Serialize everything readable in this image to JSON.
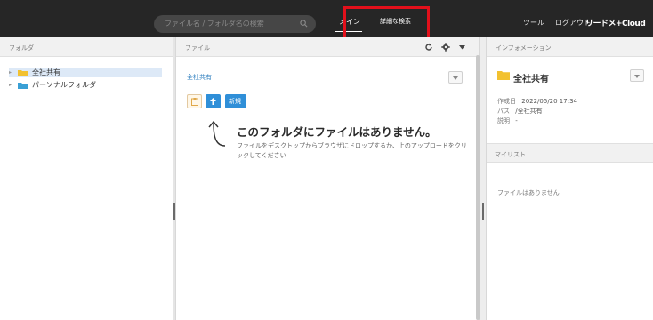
{
  "topbar": {
    "search_placeholder": "ファイル名 / フォルダ名の検索",
    "nav_main": "メイン",
    "nav_advanced_search": "詳細な検索",
    "nav_tools": "ツール",
    "nav_logout": "ログアウト",
    "logo_text": "リードメ+Cloud"
  },
  "folder_pane": {
    "header": "フォルダ",
    "items": [
      {
        "label": "全社共有",
        "selected": true,
        "folder_color": "#f2c130"
      },
      {
        "label": "パーソナルフォルダ",
        "selected": false,
        "folder_color": "#3aa0d5"
      }
    ]
  },
  "file_pane": {
    "header": "ファイル",
    "breadcrumb": "全社共有",
    "new_button_label": "新規",
    "empty_title": "このフォルダにファイルはありません。",
    "empty_description": "ファイルをデスクトップからブラウザにドロップするか、上のアップロードをクリックしてください"
  },
  "info_pane": {
    "header": "インフォメーション",
    "folder_name": "全社共有",
    "created_label": "作成日",
    "created_value": "2022/05/20 17:34",
    "path_label": "パス",
    "path_value": "/全社共有",
    "description_label": "説明",
    "description_value": "-",
    "mylist_header": "マイリスト",
    "mylist_empty": "ファイルはありません"
  },
  "colors": {
    "topbar_bg": "#262626",
    "accent_blue": "#2f8fd8",
    "highlight_red": "#e3101b"
  }
}
